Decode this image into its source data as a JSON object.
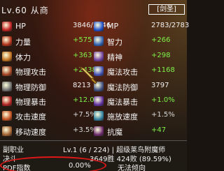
{
  "header": {
    "level_name": "Lv.60 从商",
    "faction": "[剑圣]"
  },
  "stats": [
    {
      "left": {
        "icon": "hp-icon",
        "label": "HP",
        "value": "3846/3846",
        "style": "white"
      },
      "right": {
        "icon": "mp-icon",
        "label": "MP",
        "value": "2783/2783",
        "style": "white"
      }
    },
    {
      "left": {
        "icon": "strength-icon",
        "label": "力量",
        "value": "+575",
        "style": "green"
      },
      "right": {
        "icon": "intelligence-icon",
        "label": "智力",
        "value": "+266",
        "style": "green"
      }
    },
    {
      "left": {
        "icon": "stamina-icon",
        "label": "体力",
        "value": "+363",
        "style": "green"
      },
      "right": {
        "icon": "spirit-icon",
        "label": "精神",
        "value": "+298",
        "style": "green"
      }
    },
    {
      "left": {
        "icon": "physical-attack-icon",
        "label": "物理攻击",
        "value": "+2438",
        "style": "green"
      },
      "right": {
        "icon": "magic-attack-icon",
        "label": "魔法攻击",
        "value": "+1168",
        "style": "green"
      }
    },
    {
      "left": {
        "icon": "physical-defense-icon",
        "label": "物理防御",
        "value": "8213",
        "style": "white"
      },
      "right": {
        "icon": "magic-defense-icon",
        "label": "魔法防御",
        "value": "3797",
        "style": "white"
      }
    },
    {
      "left": {
        "icon": "physical-crit-icon",
        "label": "物理暴击",
        "value": "+12.0%",
        "style": "green"
      },
      "right": {
        "icon": "magic-crit-icon",
        "label": "魔法暴击",
        "value": "+1.0%",
        "style": "green"
      }
    },
    {
      "left": {
        "icon": "attack-speed-icon",
        "label": "攻击速度",
        "value": "+7.5%",
        "style": "gray"
      },
      "right": {
        "icon": "cast-speed-icon",
        "label": "施放速度",
        "value": "+1.5%",
        "style": "gray"
      }
    },
    {
      "left": {
        "icon": "move-speed-icon",
        "label": "移动速度",
        "value": "+3.5%",
        "style": "gray"
      },
      "right": {
        "icon": "resist-icon",
        "label": "抗魔",
        "value": "+47",
        "style": "green"
      }
    }
  ],
  "bottom": {
    "subjob_label": "副职业",
    "subjob_value": "Lv.1 (6 / 224) | 超级莱鸟附魔师",
    "duel_label": "决斗",
    "duel_value": "3649胜 424败 (89.59%)",
    "pdf_label": "PDF指数",
    "pdf_value": "0.00%",
    "pdf_tendency": "无法倾向"
  },
  "colors": {
    "green": "#7ef04a",
    "circle": "#e01818"
  }
}
